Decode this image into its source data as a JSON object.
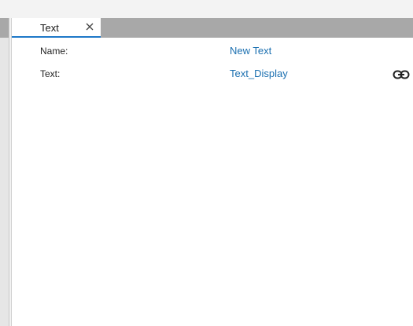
{
  "tab": {
    "label": "Text"
  },
  "properties": [
    {
      "label": "Name:",
      "value": "New Text"
    },
    {
      "label": "Text:",
      "value": "Text_Display",
      "linked_icon": "link-icon"
    }
  ],
  "colors": {
    "accent": "#1e78c8",
    "link_text": "#1a6fb0",
    "tab_strip": "#a8a8a8"
  }
}
